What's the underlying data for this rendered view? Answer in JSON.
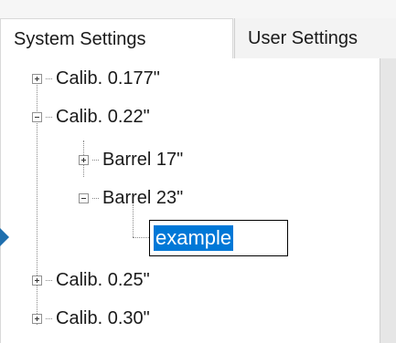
{
  "tabs": [
    {
      "label": "System Settings",
      "active": true
    },
    {
      "label": "User Settings",
      "active": false
    }
  ],
  "tree": {
    "nodes": [
      {
        "label": "Calib. 0.177\"",
        "state": "collapsed",
        "level": 0
      },
      {
        "label": "Calib. 0.22\"",
        "state": "expanded",
        "level": 0
      },
      {
        "label": "Barrel 17\"",
        "state": "collapsed",
        "level": 1
      },
      {
        "label": "Barrel 23\"",
        "state": "expanded",
        "level": 1
      },
      {
        "label": "example",
        "state": "editing",
        "level": 2
      },
      {
        "label": "Calib. 0.25\"",
        "state": "collapsed",
        "level": 0
      },
      {
        "label": "Calib. 0.30\"",
        "state": "collapsed",
        "level": 0
      }
    ],
    "edit_value": "example"
  },
  "colors": {
    "selection": "#0078d7",
    "marker": "#1f6fae"
  },
  "icons": [
    "expand-plus-icon",
    "collapse-minus-icon",
    "current-row-arrow-icon"
  ]
}
